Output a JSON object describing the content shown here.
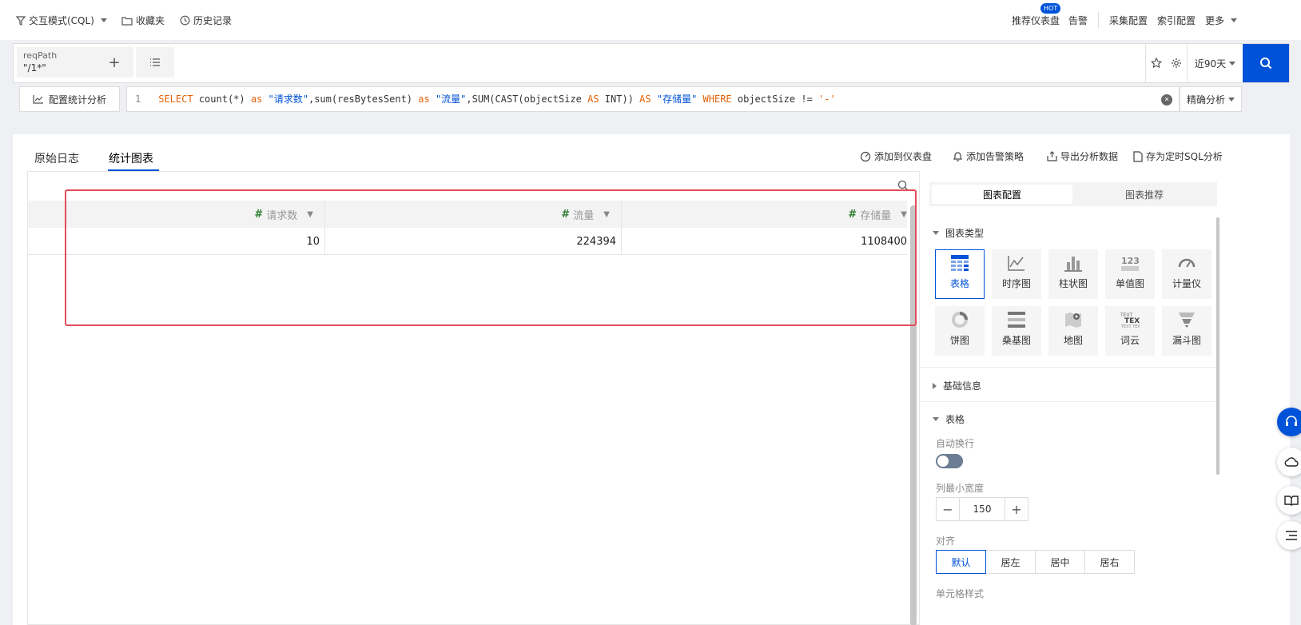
{
  "topbar": {
    "interactive_mode": "交互模式(CQL)",
    "favorites": "收藏夹",
    "history": "历史记录",
    "recommended_dashboard": "推荐仪表盘",
    "hot_badge": "HOT",
    "alarm": "告警",
    "collect_config": "采集配置",
    "index_config": "索引配置",
    "more": "更多"
  },
  "query": {
    "chip_key": "reqPath",
    "chip_value": "\"/1*\"",
    "add_symbol": "+",
    "time_range": "近90天"
  },
  "sql": {
    "config_button": "配置统计分析",
    "line_number": "1",
    "mode": "精确分析"
  },
  "tabs": {
    "raw_log": "原始日志",
    "stat_chart": "统计图表"
  },
  "actions": {
    "add_dashboard": "添加到仪表盘",
    "add_alarm": "添加告警策略",
    "export": "导出分析数据",
    "save_sql": "存为定时SQL分析"
  },
  "table": {
    "columns": [
      "请求数",
      "流量",
      "存储量"
    ],
    "rows": [
      [
        "10",
        "224394",
        "1108400"
      ]
    ]
  },
  "config": {
    "tab_config": "图表配置",
    "tab_recommend": "图表推荐",
    "chart_type_title": "图表类型",
    "chart_types": [
      "表格",
      "时序图",
      "柱状图",
      "单值图",
      "计量仪",
      "饼图",
      "桑基图",
      "地图",
      "词云",
      "漏斗图"
    ],
    "basic_info": "基础信息",
    "table_section": "表格",
    "auto_wrap": "自动换行",
    "min_col_width_label": "列最小宽度",
    "min_col_width": "150",
    "align_label": "对齐",
    "align_options": [
      "默认",
      "居左",
      "居中",
      "居右"
    ],
    "cell_style": "单元格样式"
  },
  "colors": {
    "primary": "#0052d9",
    "highlight_box": "#e34d59",
    "keyword": "#e36209"
  }
}
